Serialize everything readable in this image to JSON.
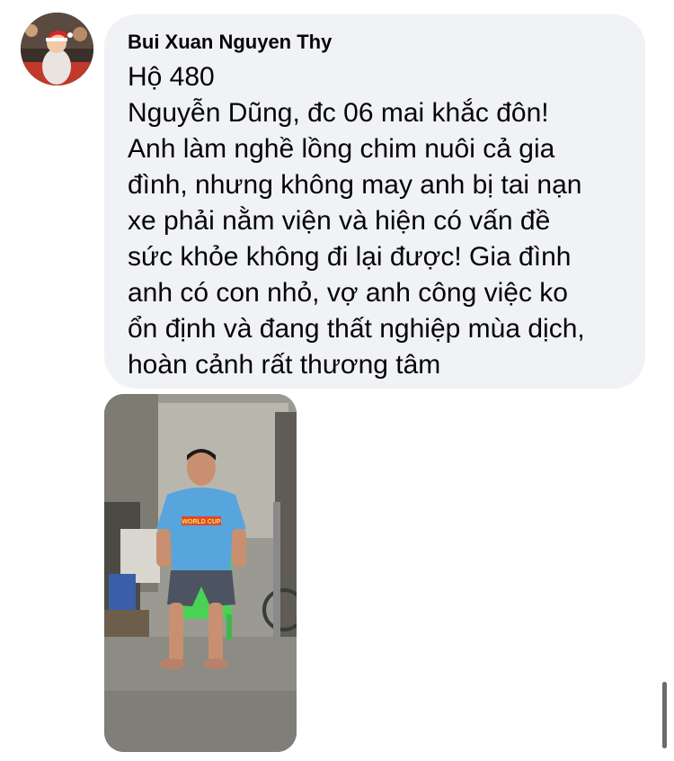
{
  "comment": {
    "author": "Bui Xuan Nguyen Thy",
    "lines": [
      "Hộ 480",
      "Nguyễn Dũng, đc 06 mai khắc đôn!",
      "Anh làm nghề lồng chim nuôi cả gia",
      "đình, nhưng không may anh bị tai nạn",
      "xe phải nằm viện và hiện có vấn đề",
      "sức khỏe không đi lại được! Gia đình",
      "anh có con nhỏ, vợ anh công việc ko",
      "ổn định và đang thất nghiệp mùa dịch,",
      "hoàn cảnh rất thương tâm"
    ]
  },
  "photo": {
    "shirt_text": "WORLD CUP"
  },
  "colors": {
    "bubble_bg": "#f0f2f5",
    "text": "#050505",
    "scrollbar": "#6b6b6b"
  },
  "icons": [
    "avatar",
    "scrollbar"
  ]
}
